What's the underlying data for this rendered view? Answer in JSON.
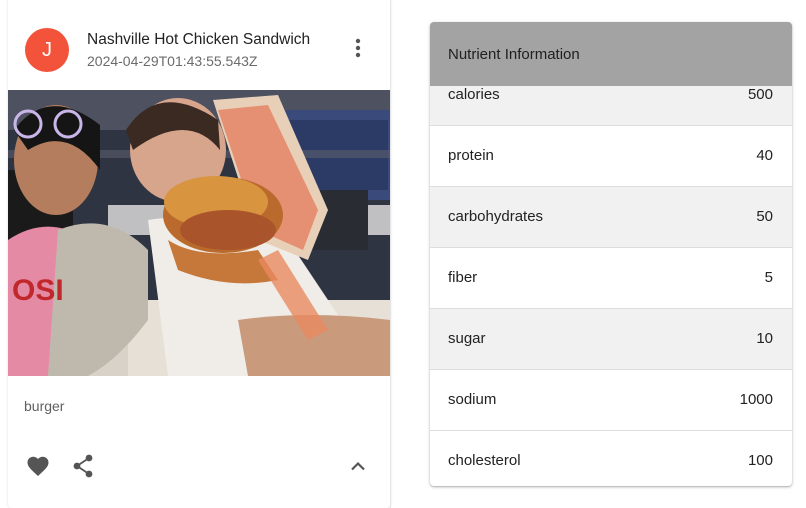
{
  "post": {
    "avatar_letter": "J",
    "title": "Nashville Hot Chicken Sandwich",
    "timestamp": "2024-04-29T01:43:55.543Z",
    "caption": "burger",
    "photo_alt": "Two people holding up a Nashville hot chicken sandwich",
    "avatar_color": "#f2533a"
  },
  "nutrients": {
    "header": "Nutrient Information",
    "header_color": "#a3a3a3",
    "rows": [
      {
        "name": "calories",
        "value": "500"
      },
      {
        "name": "protein",
        "value": "40"
      },
      {
        "name": "carbohydrates",
        "value": "50"
      },
      {
        "name": "fiber",
        "value": "5"
      },
      {
        "name": "sugar",
        "value": "10"
      },
      {
        "name": "sodium",
        "value": "1000"
      },
      {
        "name": "cholesterol",
        "value": "100"
      }
    ]
  },
  "icons": {
    "more": "more-vert-icon",
    "favorite": "heart-icon",
    "share": "share-icon",
    "expand": "chevron-up-icon"
  }
}
